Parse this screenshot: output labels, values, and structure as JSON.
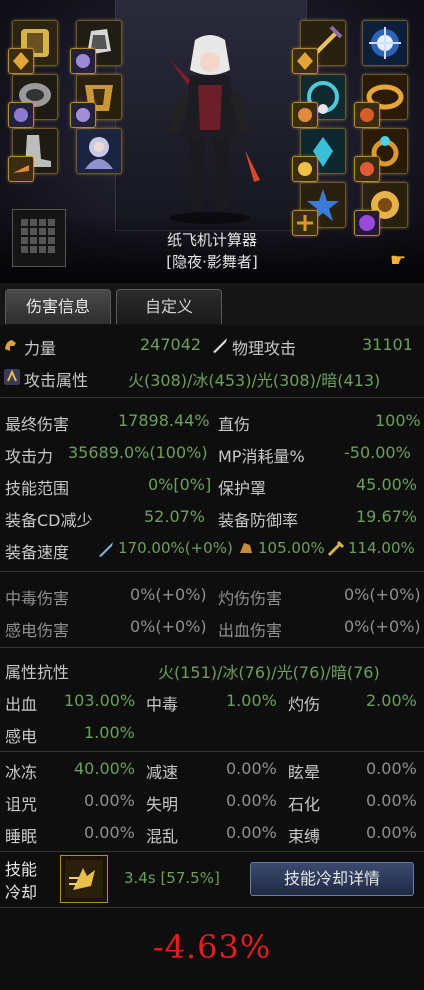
{
  "watermark": "纸飞机计算器",
  "character": {
    "name": "纸飞机计算器",
    "class": "[隐夜·影舞者]"
  },
  "equipment_icons": [
    "gold-armor-icon",
    "gauntlet-icon",
    "shoulder-icon",
    "boots-icon",
    "armor-chest-icon",
    "hair-portrait-icon",
    "weapon-sword-icon",
    "crest-icon",
    "necklace-icon",
    "bracelet-icon",
    "earring-icon",
    "ring-icon",
    "magic-stone-icon",
    "star-icon",
    "orb-icon"
  ],
  "tabs": {
    "damage_info": "伤害信息",
    "custom": "自定义"
  },
  "stats": {
    "strength_label": "力量",
    "strength_value": "247042",
    "phys_attack_label": "物理攻击",
    "phys_attack_value": "31101",
    "element_attr_label": "攻击属性",
    "element_attr_value": "火(308)/冰(453)/光(308)/暗(413)",
    "final_damage_label": "最终伤害",
    "final_damage_value": "17898.44%",
    "direct_damage_label": "直伤",
    "direct_damage_value": "100%",
    "attack_power_label": "攻击力",
    "attack_power_value": "35689.0%(100%)",
    "mp_cost_label": "MP消耗量%",
    "mp_cost_value": "-50.00%",
    "skill_range_label": "技能范围",
    "skill_range_value": "0%[0%]",
    "shield_label": "保护罩",
    "shield_value": "45.00%",
    "equip_cd_label": "装备CD减少",
    "equip_cd_value": "52.07%",
    "equip_def_label": "装备防御率",
    "equip_def_value": "19.67%",
    "equip_speed_label": "装备速度",
    "speed_attack_value": "170.00%(+0%)",
    "speed_move_value": "105.00%",
    "speed_cast_value": "114.00%",
    "poison_dmg_label": "中毒伤害",
    "poison_dmg_value": "0%(+0%)",
    "burn_dmg_label": "灼伤伤害",
    "burn_dmg_value": "0%(+0%)",
    "shock_dmg_label": "感电伤害",
    "shock_dmg_value": "0%(+0%)",
    "bleed_dmg_label": "出血伤害",
    "bleed_dmg_value": "0%(+0%)",
    "resist_label": "属性抗性",
    "resist_value": "火(151)/冰(76)/光(76)/暗(76)"
  },
  "status": {
    "bleed_label": "出血",
    "bleed_value": "103.00%",
    "poison_label": "中毒",
    "poison_value": "1.00%",
    "burn_label": "灼伤",
    "burn_value": "2.00%",
    "shock_label": "感电",
    "shock_value": "1.00%",
    "freeze_label": "冰冻",
    "freeze_value": "40.00%",
    "slow_label": "减速",
    "slow_value": "0.00%",
    "stun_label": "眩晕",
    "stun_value": "0.00%",
    "curse_label": "诅咒",
    "curse_value": "0.00%",
    "blind_label": "失明",
    "blind_value": "0.00%",
    "petrify_label": "石化",
    "petrify_value": "0.00%",
    "sleep_label": "睡眠",
    "sleep_value": "0.00%",
    "confuse_label": "混乱",
    "confuse_value": "0.00%",
    "bind_label": "束缚",
    "bind_value": "0.00%"
  },
  "cooldown": {
    "title_line1": "技能",
    "title_line2": "冷却",
    "value": "3.4s [57.5%]",
    "details_button": "技能冷却详情"
  },
  "result": "-4.63%",
  "colors": {
    "positive": "#6ba05a",
    "result": "#e41e1e",
    "gold_border": "#b98a2a"
  }
}
